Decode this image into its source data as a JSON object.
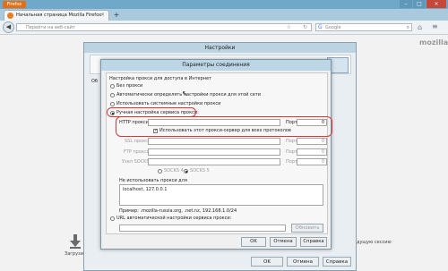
{
  "browser": {
    "menu_button_label": "Firefox",
    "window_controls": [
      "–",
      "□",
      "×"
    ],
    "tab_title": "Начальная страница Mozilla Firefox",
    "tab_close": "×",
    "new_tab": "+",
    "url_placeholder": "Перейти на веб-сайт",
    "search_engine_glyph": "G",
    "search_placeholder": "Google",
    "brand": "mozilla"
  },
  "start_page": {
    "downloads_label": "Загрузи",
    "restore_label": "дущую сессию"
  },
  "settings_dialog": {
    "title": "Настройки",
    "obscured_label": "Об",
    "ok": "OK",
    "cancel": "Отмена",
    "help": "Справка"
  },
  "connection_dialog": {
    "title": "Параметры соединения",
    "section_label": "Настройка прокси для доступа в Интернет",
    "options": {
      "no_proxy": "Без прокси",
      "auto_detect": "Автоматически определять настройки прокси для этой сети",
      "system": "Использовать системные настройки прокси",
      "manual": "Ручная настройка сервиса прокси:",
      "auto_url": "URL автоматической настройки сервиса прокси:"
    },
    "selected_option": "manual",
    "http_proxy_label": "HTTP прокси:",
    "ssl_proxy_label": "SSL прокси:",
    "ftp_proxy_label": "FTP прокси:",
    "socks_label": "Узел SOCKS:",
    "port_label": "Порт:",
    "http_port": "0",
    "ssl_port": "0",
    "ftp_port": "0",
    "socks_port": "0",
    "use_for_all_label": "Использовать этот прокси-сервер для всех протоколов",
    "use_for_all_checked": true,
    "socks4_label": "SOCKS 4",
    "socks5_label": "SOCKS 5",
    "no_proxy_for_label": "Не использовать прокси для",
    "no_proxy_for_value": "localhost, 127.0.0.1",
    "example": "Пример: .mozilla-russia.org, .net.nz, 192.168.1.0/24",
    "reload_button": "Обновить",
    "ok": "OK",
    "cancel": "Отмена",
    "help": "Справка",
    "highlight_color": "#d43a3a"
  }
}
